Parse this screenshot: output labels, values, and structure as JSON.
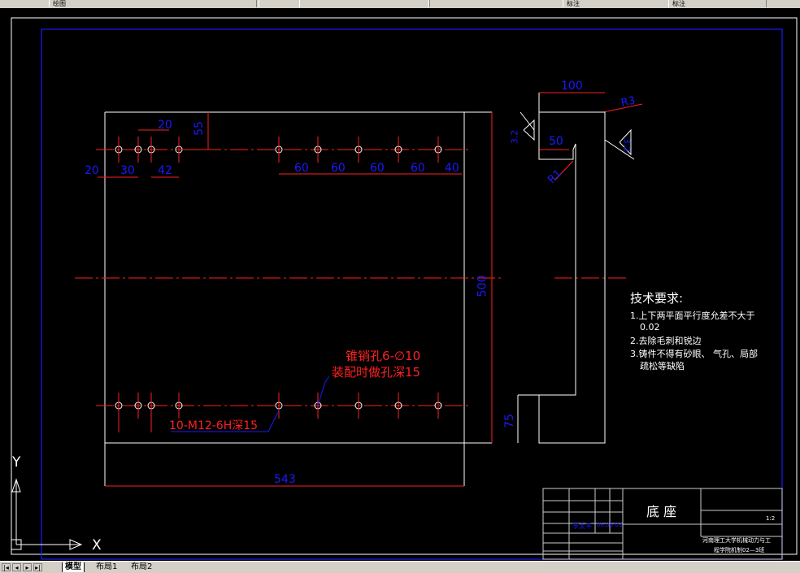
{
  "top_tabs": [
    "绘图",
    "",
    "",
    "",
    "标注",
    "标注"
  ],
  "drawing": {
    "dims": {
      "d100": "100",
      "d50": "50",
      "d20a": "20",
      "d55": "55",
      "d20b": "20",
      "d30": "30",
      "d42": "42",
      "d60a": "60",
      "d60b": "60",
      "d60c": "60",
      "d60d": "60",
      "d40": "40",
      "d500": "500",
      "d543": "543",
      "d75": "75",
      "r3": "R3",
      "r1": "R1"
    },
    "roughness": {
      "left": "3.2",
      "right": "3.2"
    },
    "callouts": {
      "pin_line1": "锥销孔6-∅10",
      "pin_line2": "装配时做孔深15",
      "thread": "10-M12-6H深15"
    }
  },
  "requirements": {
    "title": "技术要求:",
    "items": [
      "1.上下两平面平行度允差不大于",
      "0.02",
      "2.去除毛刺和锐边",
      "3.铸件不得有砂眼、 气孔、局部",
      "疏松等缺陷"
    ]
  },
  "title_block": {
    "part_name": "底 座",
    "scale": "1:2",
    "designer": "李太平",
    "date": "06.06.03",
    "school_line1": "河南理工大学机械动力与工",
    "school_line2": "程学院机制02—3班"
  },
  "ucs": {
    "y": "Y",
    "x": "X"
  },
  "bottom_tabs": [
    "模型",
    "布局1",
    "布局2"
  ],
  "colors": {
    "dim": "#ff0000",
    "text": "#0000ff",
    "line": "#ffffff",
    "frame": "#0000ff"
  }
}
